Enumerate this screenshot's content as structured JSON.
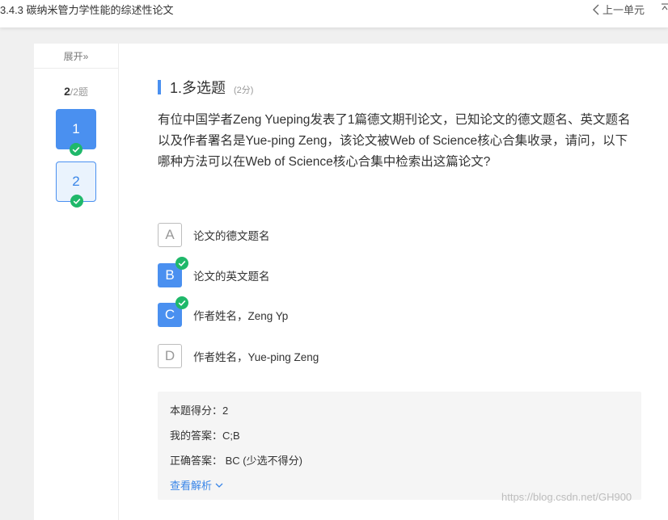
{
  "topbar": {
    "title": "3.4.3 碳纳米管力学性能的综述性论文",
    "prev_label": "上一单元"
  },
  "sidebar": {
    "expand_label": "展开»",
    "progress_current": "2",
    "progress_total": "/2题",
    "questions": [
      {
        "label": "1",
        "state": "active",
        "answered": true
      },
      {
        "label": "2",
        "state": "done",
        "answered": true
      }
    ]
  },
  "question": {
    "title": "1.多选题",
    "score": "(2分)",
    "stem": "有位中国学者Zeng Yueping发表了1篇德文期刊论文，已知论文的德文题名、英文题名以及作者署名是Yue-ping Zeng，该论文被Web of Science核心合集收录，请问，以下哪种方法可以在Web of Science核心合集中检索出这篇论文?",
    "options": [
      {
        "letter": "A",
        "text": "论文的德文题名",
        "selected": false
      },
      {
        "letter": "B",
        "text": "论文的英文题名",
        "selected": true
      },
      {
        "letter": "C",
        "text": "作者姓名，Zeng Yp",
        "selected": true
      },
      {
        "letter": "D",
        "text": "作者姓名，Yue-ping Zeng",
        "selected": false
      }
    ]
  },
  "result": {
    "score_line": "本题得分：2",
    "my_answer": "我的答案：C;B",
    "correct_answer": "正确答案： BC (少选不得分)",
    "analysis_label": "查看解析"
  },
  "watermark": "https://blog.csdn.net/GH900",
  "colors": {
    "accent": "#4a90f0",
    "check_green": "#1fb86a",
    "link": "#3a86e8"
  }
}
